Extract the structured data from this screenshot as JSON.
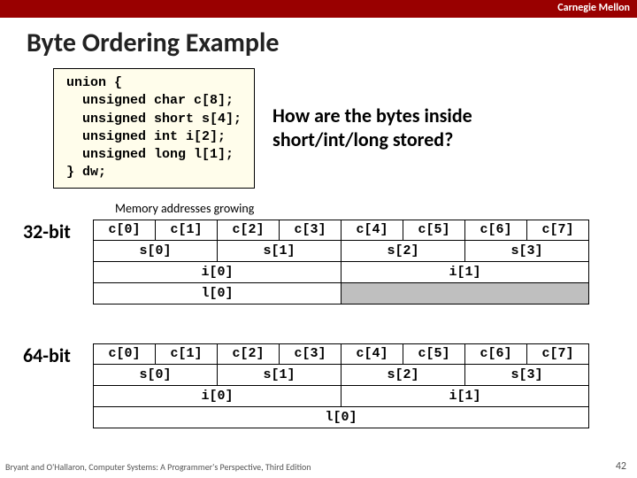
{
  "header": {
    "org": "Carnegie Mellon"
  },
  "title": "Byte Ordering Example",
  "code": "union {\n  unsigned char c[8];\n  unsigned short s[4];\n  unsigned int i[2];\n  unsigned long l[1];\n} dw;",
  "question_l1": "How are the bytes inside",
  "question_l2": "short/int/long stored?",
  "mem_label": "Memory addresses growing",
  "labels": {
    "bit32": "32-bit",
    "bit64": "64-bit"
  },
  "cells": {
    "c0": "c[0]",
    "c1": "c[1]",
    "c2": "c[2]",
    "c3": "c[3]",
    "c4": "c[4]",
    "c5": "c[5]",
    "c6": "c[6]",
    "c7": "c[7]",
    "s0": "s[0]",
    "s1": "s[1]",
    "s2": "s[2]",
    "s3": "s[3]",
    "i0": "i[0]",
    "i1": "i[1]",
    "l0": "l[0]"
  },
  "footer": "Bryant and O'Hallaron, Computer Systems: A Programmer's Perspective, Third Edition",
  "page": "42"
}
